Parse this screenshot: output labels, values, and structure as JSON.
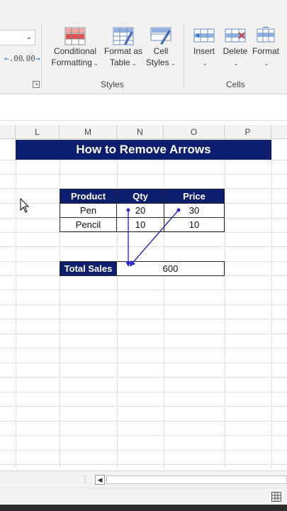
{
  "ribbon": {
    "number_format_value": "",
    "buttons": {
      "conditional_formatting": [
        "Conditional",
        "Formatting"
      ],
      "format_as_table": [
        "Format as",
        "Table"
      ],
      "cell_styles": [
        "Cell",
        "Styles"
      ],
      "insert": "Insert",
      "delete": "Delete",
      "format": "Format"
    },
    "groups": {
      "styles": "Styles",
      "cells": "Cells"
    },
    "decimal_buttons": [
      ".00",
      ".00"
    ]
  },
  "columns": [
    "L",
    "M",
    "N",
    "O",
    "P"
  ],
  "sheet": {
    "title": "How to Remove Arrows",
    "table_headers": [
      "Product",
      "Qty",
      "Price"
    ],
    "rows": [
      [
        "Pen",
        "20",
        "30"
      ],
      [
        "Pencil",
        "10",
        "10"
      ]
    ],
    "total_label": "Total Sales",
    "total_value": "600"
  },
  "colors": {
    "header_fill": "#0d1e6e",
    "arrow": "#2929c8"
  }
}
